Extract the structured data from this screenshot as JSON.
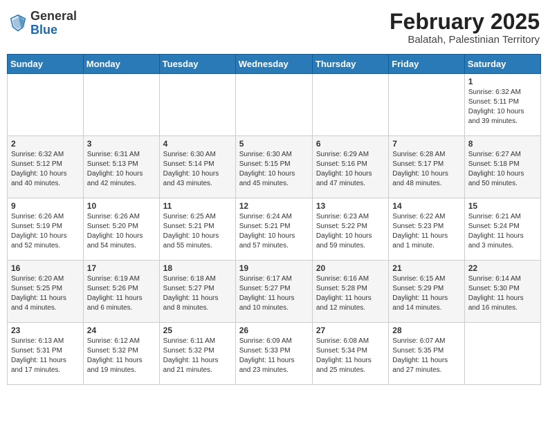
{
  "header": {
    "logo_general": "General",
    "logo_blue": "Blue",
    "month_year": "February 2025",
    "location": "Balatah, Palestinian Territory"
  },
  "days_of_week": [
    "Sunday",
    "Monday",
    "Tuesday",
    "Wednesday",
    "Thursday",
    "Friday",
    "Saturday"
  ],
  "weeks": [
    [
      {
        "day": "",
        "info": ""
      },
      {
        "day": "",
        "info": ""
      },
      {
        "day": "",
        "info": ""
      },
      {
        "day": "",
        "info": ""
      },
      {
        "day": "",
        "info": ""
      },
      {
        "day": "",
        "info": ""
      },
      {
        "day": "1",
        "info": "Sunrise: 6:32 AM\nSunset: 5:11 PM\nDaylight: 10 hours\nand 39 minutes."
      }
    ],
    [
      {
        "day": "2",
        "info": "Sunrise: 6:32 AM\nSunset: 5:12 PM\nDaylight: 10 hours\nand 40 minutes."
      },
      {
        "day": "3",
        "info": "Sunrise: 6:31 AM\nSunset: 5:13 PM\nDaylight: 10 hours\nand 42 minutes."
      },
      {
        "day": "4",
        "info": "Sunrise: 6:30 AM\nSunset: 5:14 PM\nDaylight: 10 hours\nand 43 minutes."
      },
      {
        "day": "5",
        "info": "Sunrise: 6:30 AM\nSunset: 5:15 PM\nDaylight: 10 hours\nand 45 minutes."
      },
      {
        "day": "6",
        "info": "Sunrise: 6:29 AM\nSunset: 5:16 PM\nDaylight: 10 hours\nand 47 minutes."
      },
      {
        "day": "7",
        "info": "Sunrise: 6:28 AM\nSunset: 5:17 PM\nDaylight: 10 hours\nand 48 minutes."
      },
      {
        "day": "8",
        "info": "Sunrise: 6:27 AM\nSunset: 5:18 PM\nDaylight: 10 hours\nand 50 minutes."
      }
    ],
    [
      {
        "day": "9",
        "info": "Sunrise: 6:26 AM\nSunset: 5:19 PM\nDaylight: 10 hours\nand 52 minutes."
      },
      {
        "day": "10",
        "info": "Sunrise: 6:26 AM\nSunset: 5:20 PM\nDaylight: 10 hours\nand 54 minutes."
      },
      {
        "day": "11",
        "info": "Sunrise: 6:25 AM\nSunset: 5:21 PM\nDaylight: 10 hours\nand 55 minutes."
      },
      {
        "day": "12",
        "info": "Sunrise: 6:24 AM\nSunset: 5:21 PM\nDaylight: 10 hours\nand 57 minutes."
      },
      {
        "day": "13",
        "info": "Sunrise: 6:23 AM\nSunset: 5:22 PM\nDaylight: 10 hours\nand 59 minutes."
      },
      {
        "day": "14",
        "info": "Sunrise: 6:22 AM\nSunset: 5:23 PM\nDaylight: 11 hours\nand 1 minute."
      },
      {
        "day": "15",
        "info": "Sunrise: 6:21 AM\nSunset: 5:24 PM\nDaylight: 11 hours\nand 3 minutes."
      }
    ],
    [
      {
        "day": "16",
        "info": "Sunrise: 6:20 AM\nSunset: 5:25 PM\nDaylight: 11 hours\nand 4 minutes."
      },
      {
        "day": "17",
        "info": "Sunrise: 6:19 AM\nSunset: 5:26 PM\nDaylight: 11 hours\nand 6 minutes."
      },
      {
        "day": "18",
        "info": "Sunrise: 6:18 AM\nSunset: 5:27 PM\nDaylight: 11 hours\nand 8 minutes."
      },
      {
        "day": "19",
        "info": "Sunrise: 6:17 AM\nSunset: 5:27 PM\nDaylight: 11 hours\nand 10 minutes."
      },
      {
        "day": "20",
        "info": "Sunrise: 6:16 AM\nSunset: 5:28 PM\nDaylight: 11 hours\nand 12 minutes."
      },
      {
        "day": "21",
        "info": "Sunrise: 6:15 AM\nSunset: 5:29 PM\nDaylight: 11 hours\nand 14 minutes."
      },
      {
        "day": "22",
        "info": "Sunrise: 6:14 AM\nSunset: 5:30 PM\nDaylight: 11 hours\nand 16 minutes."
      }
    ],
    [
      {
        "day": "23",
        "info": "Sunrise: 6:13 AM\nSunset: 5:31 PM\nDaylight: 11 hours\nand 17 minutes."
      },
      {
        "day": "24",
        "info": "Sunrise: 6:12 AM\nSunset: 5:32 PM\nDaylight: 11 hours\nand 19 minutes."
      },
      {
        "day": "25",
        "info": "Sunrise: 6:11 AM\nSunset: 5:32 PM\nDaylight: 11 hours\nand 21 minutes."
      },
      {
        "day": "26",
        "info": "Sunrise: 6:09 AM\nSunset: 5:33 PM\nDaylight: 11 hours\nand 23 minutes."
      },
      {
        "day": "27",
        "info": "Sunrise: 6:08 AM\nSunset: 5:34 PM\nDaylight: 11 hours\nand 25 minutes."
      },
      {
        "day": "28",
        "info": "Sunrise: 6:07 AM\nSunset: 5:35 PM\nDaylight: 11 hours\nand 27 minutes."
      },
      {
        "day": "",
        "info": ""
      }
    ]
  ]
}
